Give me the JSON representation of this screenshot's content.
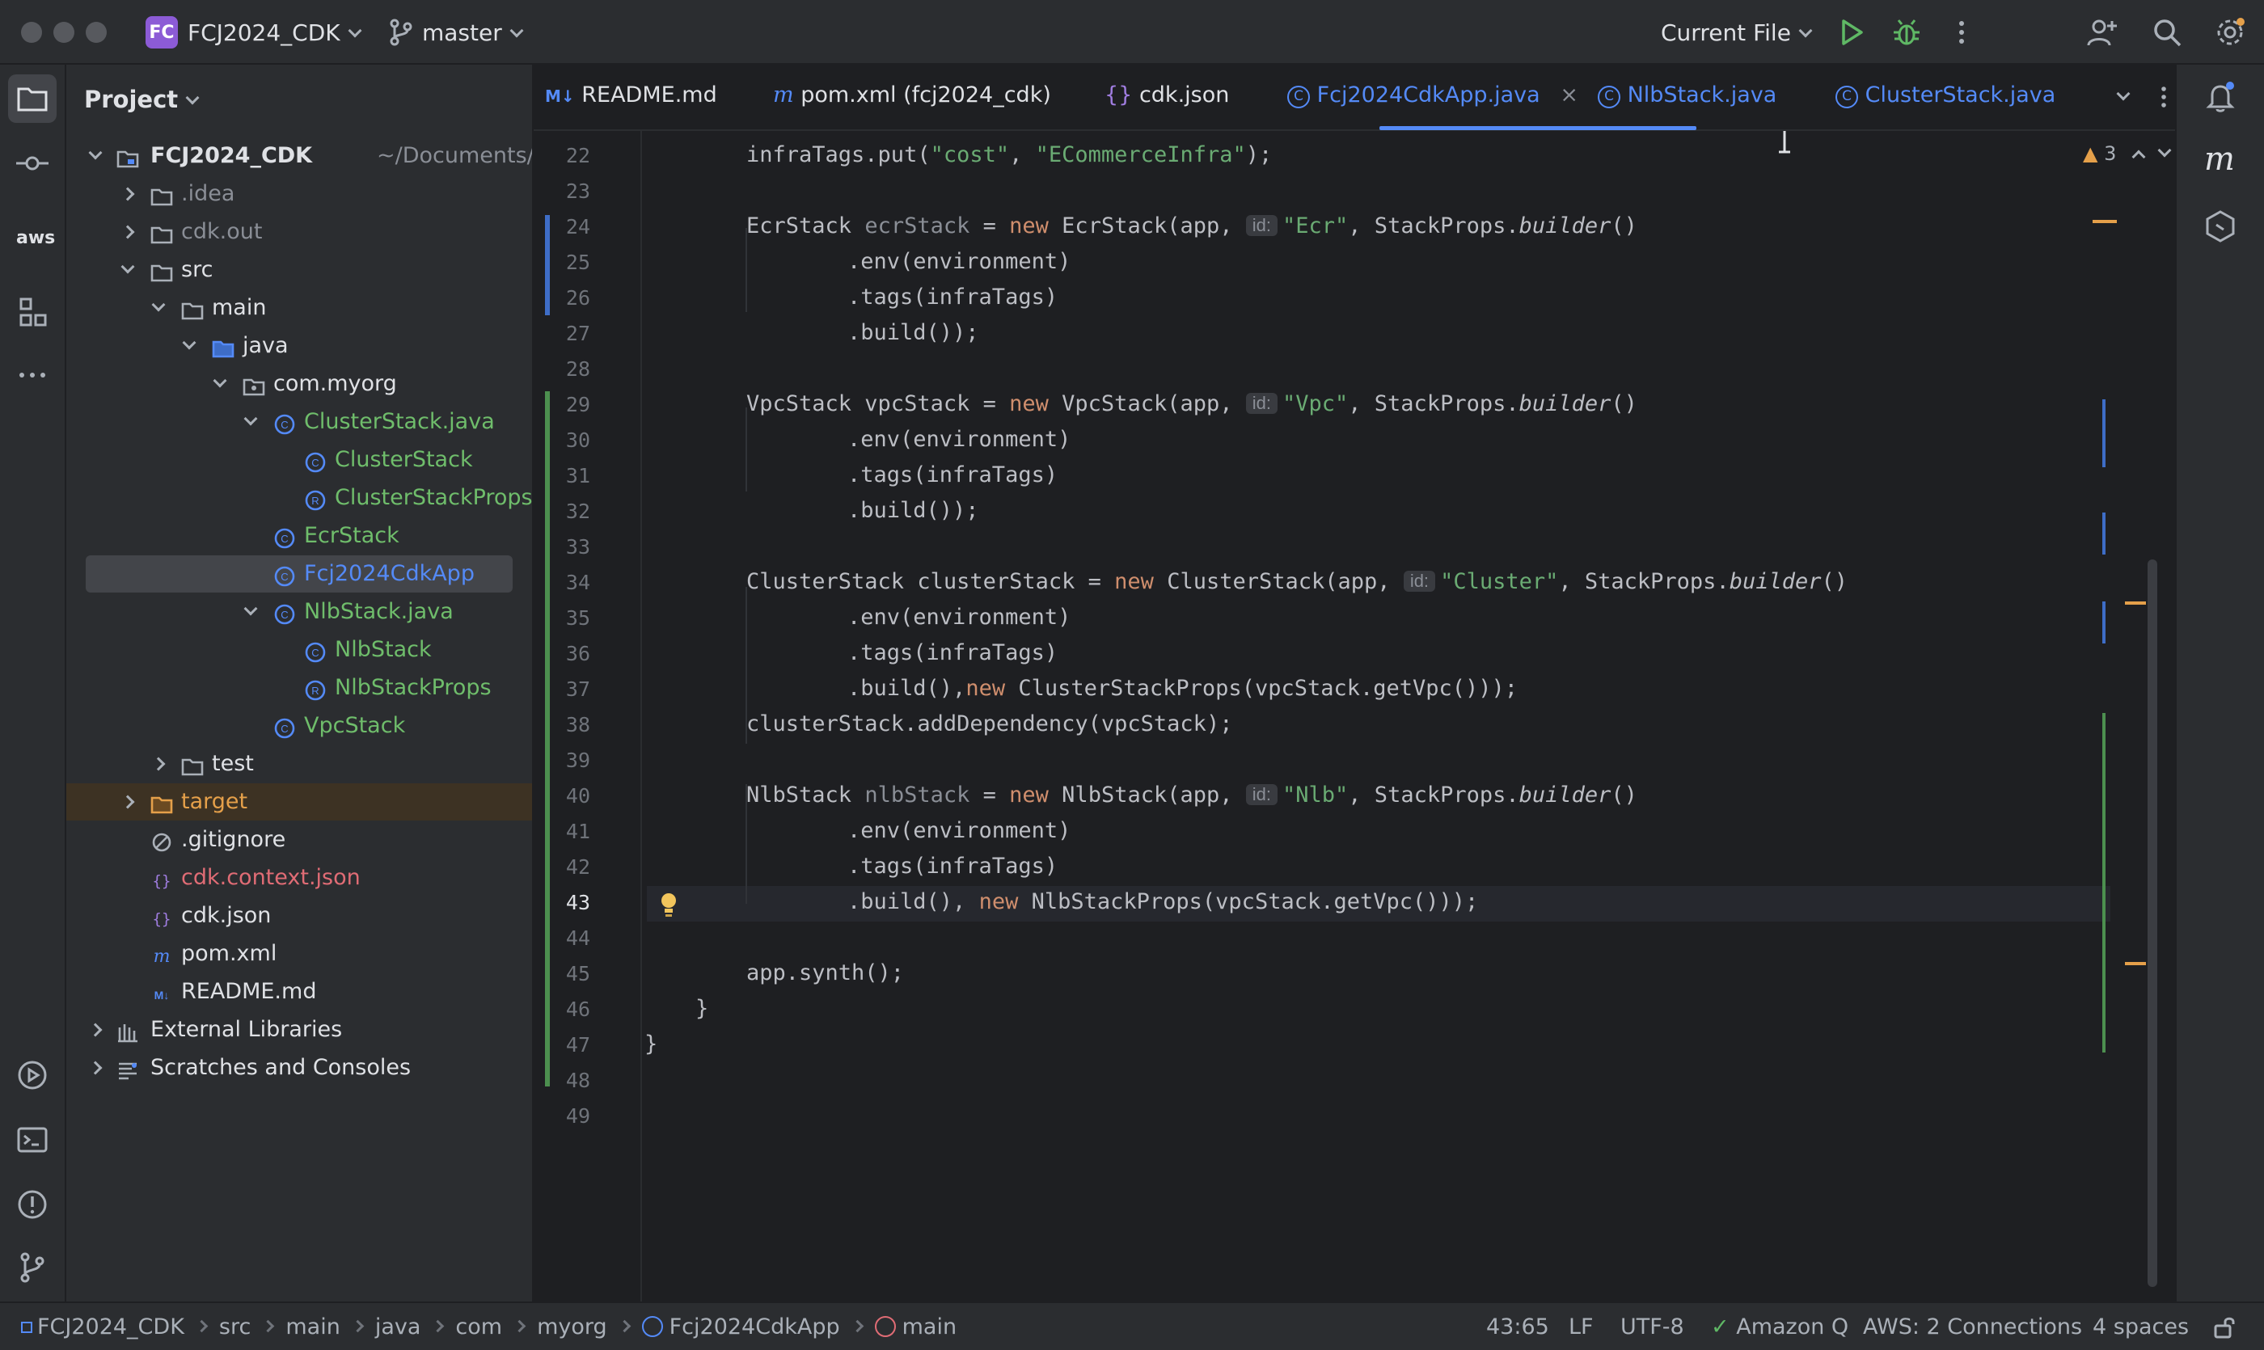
{
  "titlebar": {
    "project_badge": "FC",
    "project_name": "FCJ2024_CDK",
    "branch": "master",
    "run_config": "Current File"
  },
  "project_panel": {
    "title": "Project",
    "tree": [
      {
        "label": "FCJ2024_CDK",
        "suffix": "~/Documents/workshop",
        "icon": "module-folder-icon"
      },
      {
        "label": ".idea",
        "icon": "folder-icon"
      },
      {
        "label": "cdk.out",
        "icon": "folder-icon"
      },
      {
        "label": "src",
        "icon": "folder-icon"
      },
      {
        "label": "main",
        "icon": "folder-icon"
      },
      {
        "label": "java",
        "icon": "source-folder-icon"
      },
      {
        "label": "com.myorg",
        "icon": "package-icon"
      },
      {
        "label": "ClusterStack.java",
        "icon": "class-icon"
      },
      {
        "label": "ClusterStack",
        "icon": "class-icon"
      },
      {
        "label": "ClusterStackProps",
        "icon": "record-icon"
      },
      {
        "label": "EcrStack",
        "icon": "class-icon"
      },
      {
        "label": "Fcj2024CdkApp",
        "icon": "class-icon"
      },
      {
        "label": "NlbStack.java",
        "icon": "class-icon"
      },
      {
        "label": "NlbStack",
        "icon": "class-icon"
      },
      {
        "label": "NlbStackProps",
        "icon": "record-icon"
      },
      {
        "label": "VpcStack",
        "icon": "class-icon"
      },
      {
        "label": "test",
        "icon": "folder-icon"
      },
      {
        "label": "target",
        "icon": "excluded-folder-icon"
      },
      {
        "label": ".gitignore",
        "icon": "ignore-icon"
      },
      {
        "label": "cdk.context.json",
        "icon": "json-icon"
      },
      {
        "label": "cdk.json",
        "icon": "json-icon"
      },
      {
        "label": "pom.xml",
        "icon": "maven-icon"
      },
      {
        "label": "README.md",
        "icon": "markdown-icon"
      },
      {
        "label": "External Libraries",
        "icon": "library-icon"
      },
      {
        "label": "Scratches and Consoles",
        "icon": "scratches-icon"
      }
    ]
  },
  "tabs": [
    {
      "label": "README.md",
      "icon": "M↓"
    },
    {
      "label": "pom.xml (fcj2024_cdk)",
      "icon": "m"
    },
    {
      "label": "cdk.json",
      "icon": "{}"
    },
    {
      "label": "Fcj2024CdkApp.java",
      "icon": "C"
    },
    {
      "label": "NlbStack.java",
      "icon": "C"
    },
    {
      "label": "ClusterStack.java",
      "icon": "C"
    }
  ],
  "editor": {
    "warnings": "3",
    "line_numbers": [
      "22",
      "23",
      "24",
      "25",
      "26",
      "27",
      "28",
      "29",
      "30",
      "31",
      "32",
      "33",
      "34",
      "35",
      "36",
      "37",
      "38",
      "39",
      "40",
      "41",
      "42",
      "43",
      "44",
      "45",
      "46",
      "47",
      "48",
      "49"
    ],
    "hints": {
      "id": "id:"
    },
    "code": {
      "l22a": "infraTags.put(",
      "l22b": "\"cost\"",
      "l22c": ", ",
      "l22d": "\"ECommerceInfra\"",
      "l22e": ");",
      "ecr_type": "EcrStack ",
      "ecr_var": "ecrStack",
      "eq": " = ",
      "new": "new",
      "ecr_ctor": " EcrStack(app, ",
      "ecr_id": "\"Ecr\"",
      "props": ", StackProps.",
      "builder": "builder",
      "paren": "()",
      "env": ".env(environment)",
      "tags": ".tags(infraTags)",
      "build": ".build());",
      "vpc_type": "VpcStack vpcStack",
      "vpc_ctor": " VpcStack(app, ",
      "vpc_id": "\"Vpc\"",
      "cl_type": "ClusterStack clusterStack",
      "cl_ctor": " ClusterStack(app, ",
      "cl_id": "\"Cluster\"",
      "cl_build_a": ".build(),",
      "cl_build_b": " ClusterStackProps(vpcStack.getVpc()));",
      "cl_dep": "clusterStack.addDependency(vpcStack);",
      "nlb_type": "NlbStack ",
      "nlb_var": "nlbStack",
      "nlb_ctor": " NlbStack(app, ",
      "nlb_id": "\"Nlb\"",
      "nlb_build_a": ".build(), ",
      "nlb_build_b": " NlbStackProps(vpcStack.getVpc()));",
      "synth": "app.synth();",
      "brace": "}"
    }
  },
  "statusbar": {
    "breadcrumb": [
      "FCJ2024_CDK",
      "src",
      "main",
      "java",
      "com",
      "myorg",
      "Fcj2024CdkApp",
      "main"
    ],
    "position": "43:65",
    "line_sep": "LF",
    "encoding": "UTF-8",
    "amazon_q": "Amazon Q",
    "aws": "AWS: 2 Connections",
    "indent": "4 spaces"
  }
}
